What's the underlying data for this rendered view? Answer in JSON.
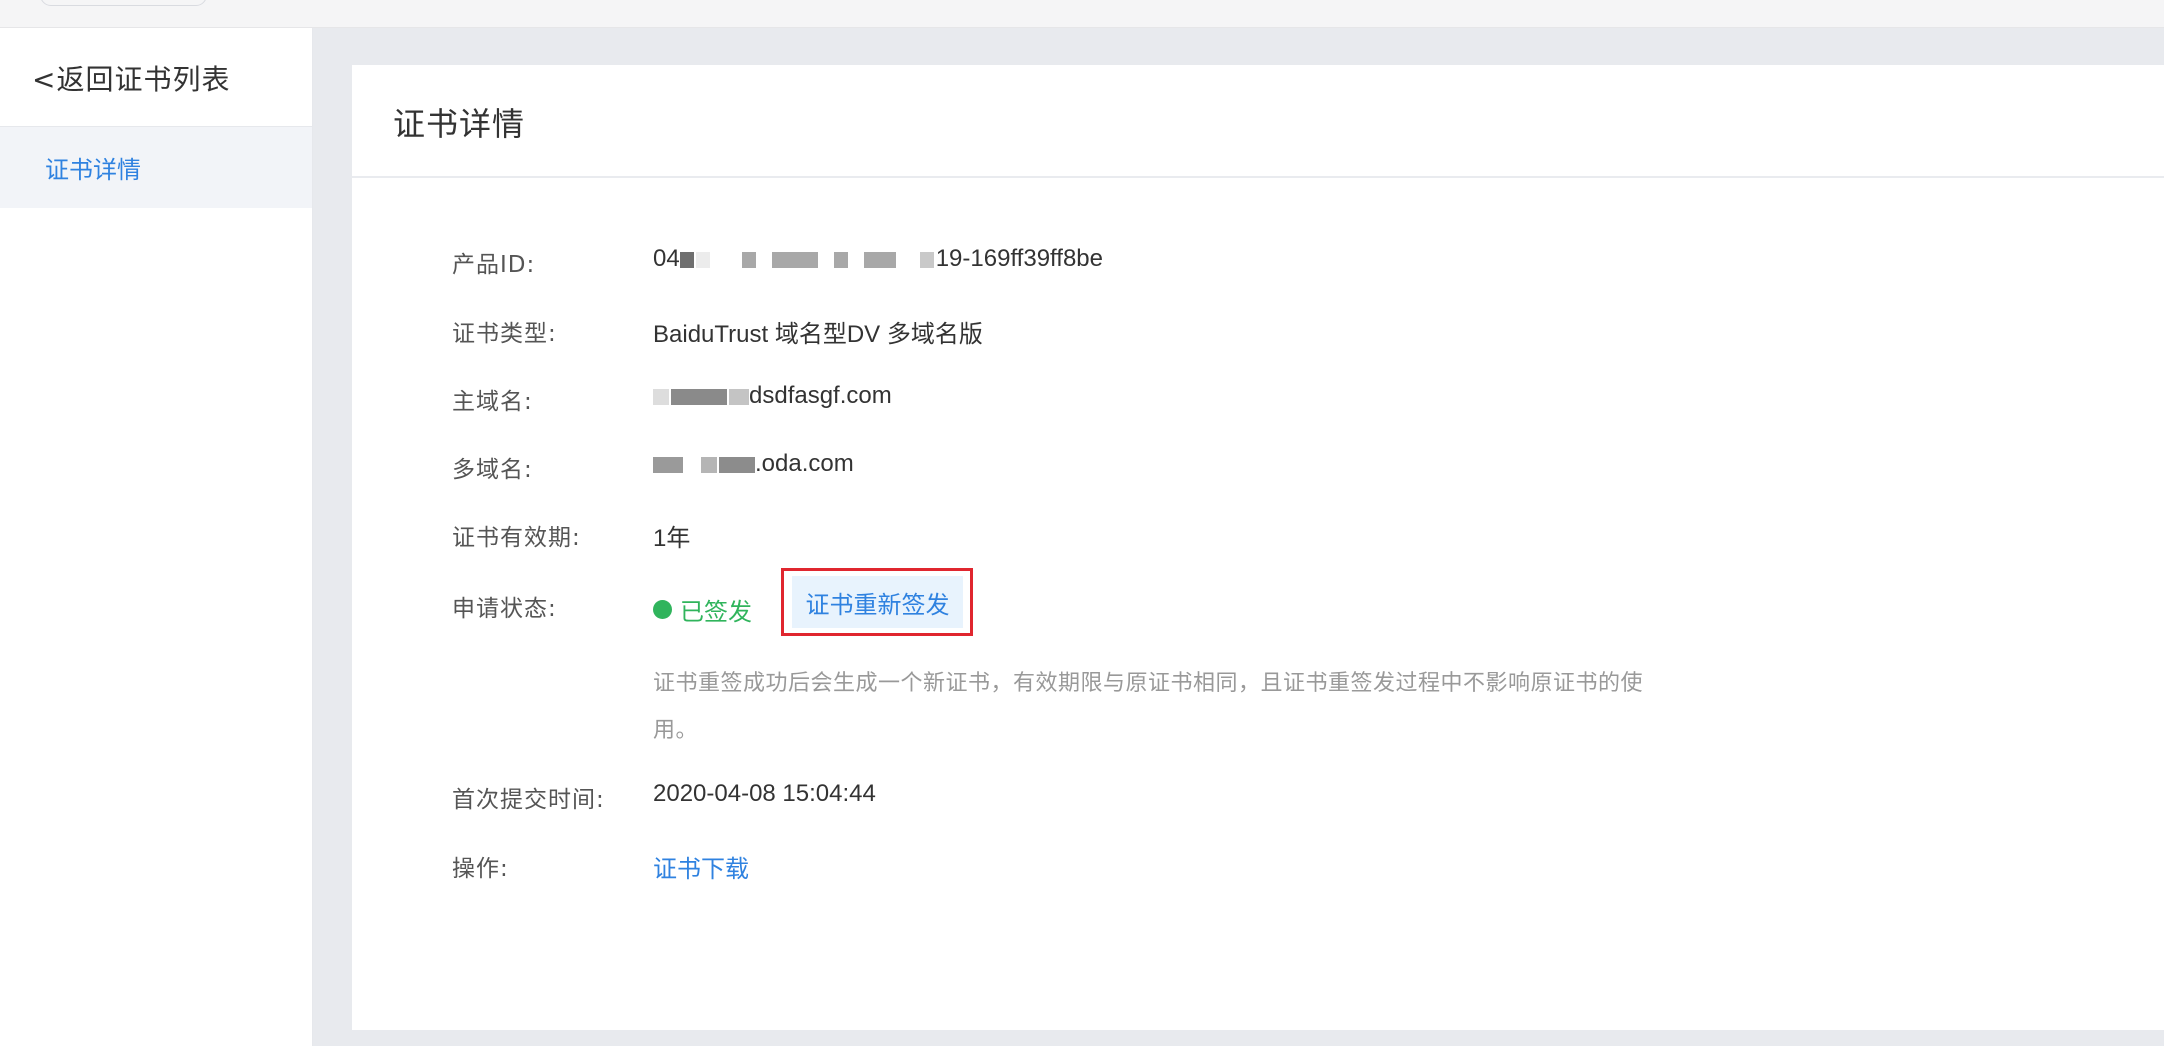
{
  "sidebar": {
    "back_label": "<返回证书列表",
    "items": [
      {
        "label": "证书详情",
        "active": true
      }
    ]
  },
  "main": {
    "title": "证书详情",
    "fields": {
      "product_id": {
        "label": "产品ID:",
        "value_visible": "-169ff39ff8be",
        "value_prefix_visible": "04",
        "value_mid_visible": "19"
      },
      "cert_type": {
        "label": "证书类型:",
        "value": "BaiduTrust 域名型DV 多域名版"
      },
      "main_domain": {
        "label": "主域名:",
        "value_visible": "dsdfasgf.com"
      },
      "multi_domain": {
        "label": "多域名:",
        "value_visible": ".oda.com"
      },
      "validity": {
        "label": "证书有效期:",
        "value": "1年"
      },
      "apply_status": {
        "label": "申请状态:",
        "status": "已签发",
        "status_color": "#30b45c",
        "reissue_button": "证书重新签发",
        "note": "证书重签成功后会生成一个新证书，有效期限与原证书相同，且证书重签发过程中不影响原证书的使用。"
      },
      "first_submit_time": {
        "label": "首次提交时间:",
        "value": "2020-04-08 15:04:44"
      },
      "operations": {
        "label": "操作:",
        "download_link": "证书下载"
      }
    }
  },
  "colors": {
    "accent": "#2f82e0",
    "success": "#30b45c",
    "highlight": "#e0262f",
    "background": "#e8eaee"
  }
}
